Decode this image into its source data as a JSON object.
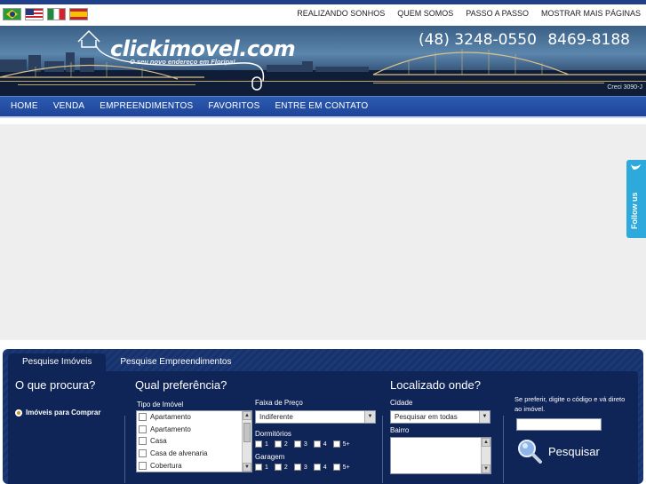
{
  "flags": [
    {
      "name": "brazil-flag-icon",
      "cls": "br"
    },
    {
      "name": "usa-flag-icon",
      "cls": "us"
    },
    {
      "name": "italy-flag-icon",
      "cls": "it"
    },
    {
      "name": "spain-flag-icon",
      "cls": "es"
    }
  ],
  "top_menu": [
    "REALIZANDO SONHOS",
    "QUEM SOMOS",
    "PASSO A PASSO",
    "MOSTRAR MAIS PÁGINAS"
  ],
  "header": {
    "logo_text": "clickimovel.com",
    "logo_tagline": "O seu novo endereço em Floripa!",
    "phone_1": "(48) 3248-0550",
    "phone_2": "8469-8188",
    "creci": "Creci 3090-J"
  },
  "main_nav": [
    "HOME",
    "VENDA",
    "EMPREENDIMENTOS",
    "FAVORITOS",
    "ENTRE EM CONTATO"
  ],
  "follow_us": "Follow us",
  "search": {
    "tabs": [
      "Pesquise Imóveis",
      "Pesquise Empreendimentos"
    ],
    "what_heading": "O que procura?",
    "buy_option": "Imóveis para Comprar",
    "preference_heading": "Qual preferência?",
    "property_type_label": "Tipo de Imóvel",
    "property_types": [
      "Apartamento",
      "Apartamento",
      "Casa",
      "Casa de alvenaria",
      "Cobertura"
    ],
    "price_label": "Faixa de Preço",
    "price_value": "Indiferente",
    "bedrooms_label": "Dormitórios",
    "garage_label": "Garagem",
    "count_options": [
      "1",
      "2",
      "3",
      "4",
      "5+"
    ],
    "location_heading": "Localizado onde?",
    "city_label": "Cidade",
    "city_value": "Pesquisar em todas",
    "neighborhood_label": "Bairro",
    "code_hint": "Se preferir, digite o código e vá direto ao imóvel.",
    "search_button": "Pesquisar"
  },
  "colors": {
    "nav_blue": "#1e449a",
    "panel_navy": "#0f2457",
    "follow_blue": "#2da9dc"
  }
}
